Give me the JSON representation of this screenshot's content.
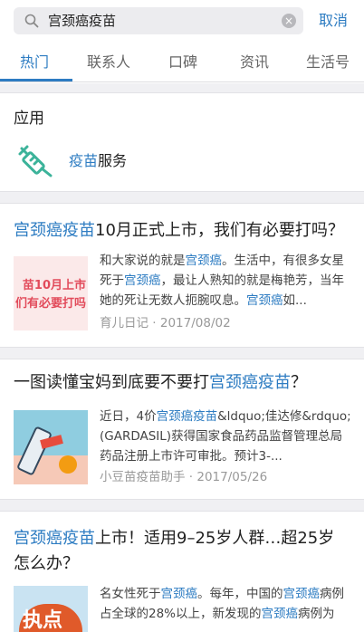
{
  "search": {
    "query": "宫颈癌疫苗",
    "cancel_label": "取消"
  },
  "tabs": [
    {
      "label": "热门",
      "active": true
    },
    {
      "label": "联系人",
      "active": false
    },
    {
      "label": "口碑",
      "active": false
    },
    {
      "label": "资讯",
      "active": false
    },
    {
      "label": "生活号",
      "active": false
    }
  ],
  "apps": {
    "heading": "应用",
    "item": {
      "highlight": "疫苗",
      "rest": "服务",
      "icon": "syringe-icon"
    }
  },
  "articles": [
    {
      "title_pre": "",
      "title_hl": "宫颈癌疫苗",
      "title_post": "10月正式上市，我们有必要打吗？",
      "thumb_text_1": "苗10月上市",
      "thumb_text_2": "们有必要打吗",
      "snippet": [
        {
          "t": "和大家说的就是",
          "h": false
        },
        {
          "t": "宫颈癌",
          "h": true
        },
        {
          "t": "。生活中，有很多女星死于",
          "h": false
        },
        {
          "t": "宫颈癌",
          "h": true
        },
        {
          "t": "，最让人熟知的就是梅艳芳，当年她的死让无数人扼腕叹息。",
          "h": false
        },
        {
          "t": "宫颈癌",
          "h": true
        },
        {
          "t": "如...",
          "h": false
        }
      ],
      "source": "育儿日记",
      "date": "2017/08/02"
    },
    {
      "title_pre": "一图读懂宝妈到底要不要打",
      "title_hl": "宫颈癌疫苗",
      "title_post": "？",
      "snippet": [
        {
          "t": "近日，4价",
          "h": false
        },
        {
          "t": "宫颈癌疫苗",
          "h": true
        },
        {
          "t": "&ldquo;佳达修&rdquo;(GARDASIL)获得国家食品药品监督管理总局药品注册上市许可审批。预计3-...",
          "h": false
        }
      ],
      "source": "小豆苗疫苗助手",
      "date": "2017/05/26"
    },
    {
      "title_pre": "",
      "title_hl": "宫颈癌疫苗",
      "title_post": "上市！适用9–25岁人群…超25岁怎么办？",
      "thumb_text_1": "执点",
      "snippet": [
        {
          "t": "名女性死于",
          "h": false
        },
        {
          "t": "宫颈癌",
          "h": true
        },
        {
          "t": "。每年，中国的",
          "h": false
        },
        {
          "t": "宫颈癌",
          "h": true
        },
        {
          "t": "病例占全球的28%以上，新发现的",
          "h": false
        },
        {
          "t": "宫颈癌",
          "h": true
        },
        {
          "t": "病例为",
          "h": false
        }
      ]
    }
  ],
  "colors": {
    "accent": "#2d7cc2",
    "icon_green": "#3cb39a"
  }
}
